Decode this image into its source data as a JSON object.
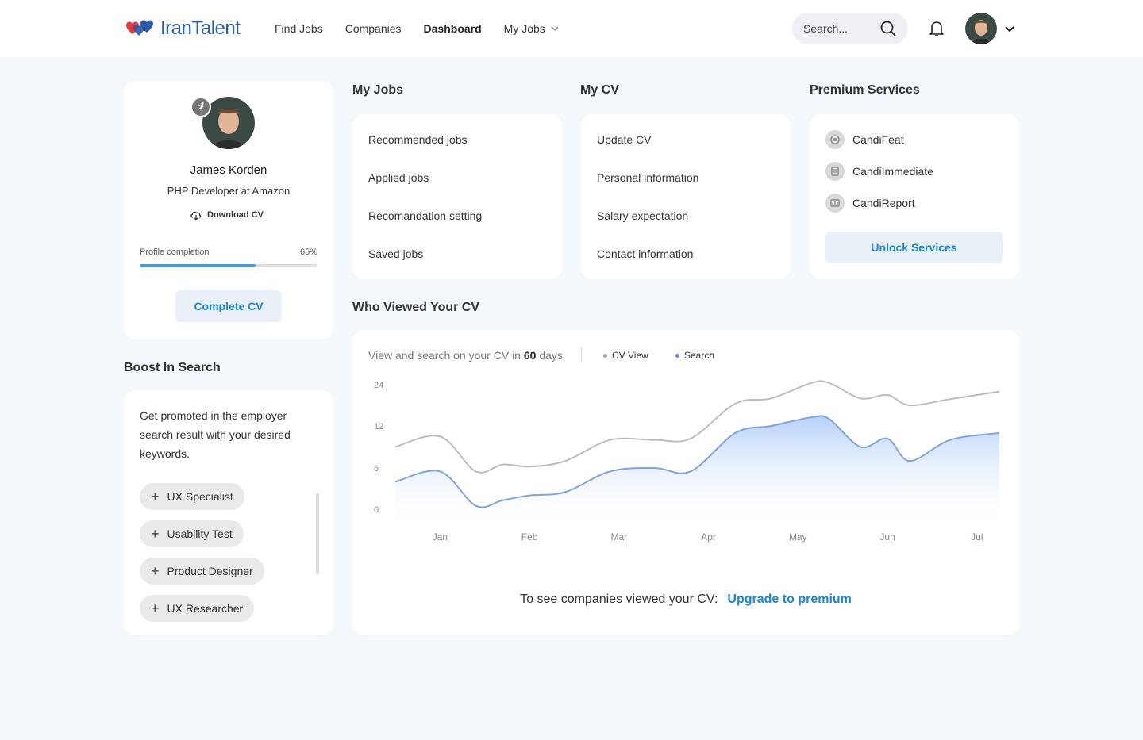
{
  "brand": {
    "name": "IranTalent"
  },
  "nav": {
    "items": [
      {
        "label": "Find Jobs",
        "active": false
      },
      {
        "label": "Companies",
        "active": false
      },
      {
        "label": "Dashboard",
        "active": true
      },
      {
        "label": "My Jobs",
        "active": false,
        "dropdown": true
      }
    ]
  },
  "header": {
    "search_placeholder": "Search..."
  },
  "profile": {
    "name": "James Korden",
    "role": "PHP Developer at Amazon",
    "download_label": "Download CV",
    "completion_label": "Profile completion",
    "completion_value": "65%",
    "completion_fraction": 0.65,
    "complete_button": "Complete CV"
  },
  "my_jobs": {
    "title": "My Jobs",
    "items": [
      "Recommended jobs",
      "Applied jobs",
      "Recomandation setting",
      "Saved jobs"
    ]
  },
  "my_cv": {
    "title": "My CV",
    "items": [
      "Update CV",
      "Personal information",
      "Salary expectation",
      "Contact information"
    ]
  },
  "premium": {
    "title": "Premium Services",
    "items": [
      "CandiFeat",
      "CandiImmediate",
      "CandiReport"
    ],
    "unlock_button": "Unlock Services"
  },
  "boost": {
    "title": "Boost In Search",
    "description": "Get promoted in the employer search result with your desired keywords.",
    "tags": [
      "UX Specialist",
      "Usability Test",
      "Product Designer",
      "UX Researcher"
    ]
  },
  "viewed": {
    "title": "Who Viewed Your CV",
    "caption_prefix": "View and search on your CV in ",
    "caption_days": "60",
    "caption_suffix": " days",
    "upgrade_text": "To see companies viewed your CV:",
    "upgrade_link": "Upgrade to premium"
  },
  "colors": {
    "accent": "#1b86d6",
    "cv_view": "#bdbdbd",
    "search": "#7fa3e6"
  },
  "chart_data": {
    "type": "area",
    "x": [
      0,
      0.5,
      0.9,
      1.2,
      1.5,
      1.9,
      2.4,
      2.9,
      3.3,
      3.8,
      4.2,
      4.65,
      4.85,
      5.2,
      5.5,
      5.75,
      6.2,
      6.75
    ],
    "tick_labels": [
      "Jan",
      "Feb",
      "Mar",
      "Apr",
      "May",
      "Jun",
      "Jul"
    ],
    "tick_positions": [
      0.5,
      1.5,
      2.5,
      3.5,
      4.5,
      5.5,
      6.5
    ],
    "ylim": [
      0,
      24
    ],
    "yticks": [
      0,
      6,
      12,
      24
    ],
    "series": [
      {
        "name": "CV View",
        "values": [
          9,
          10.5,
          5.5,
          6.5,
          6.2,
          7,
          10,
          10,
          10.2,
          18.5,
          20,
          24.5,
          24.5,
          20,
          21,
          18,
          19.8,
          22
        ]
      },
      {
        "name": "Search",
        "values": [
          4,
          5.5,
          0.5,
          1.3,
          2,
          2.5,
          5.5,
          6,
          5.5,
          11,
          12,
          14.5,
          14,
          9,
          10.2,
          7,
          10,
          11
        ]
      }
    ],
    "legend_placement": "top",
    "grid": false
  }
}
